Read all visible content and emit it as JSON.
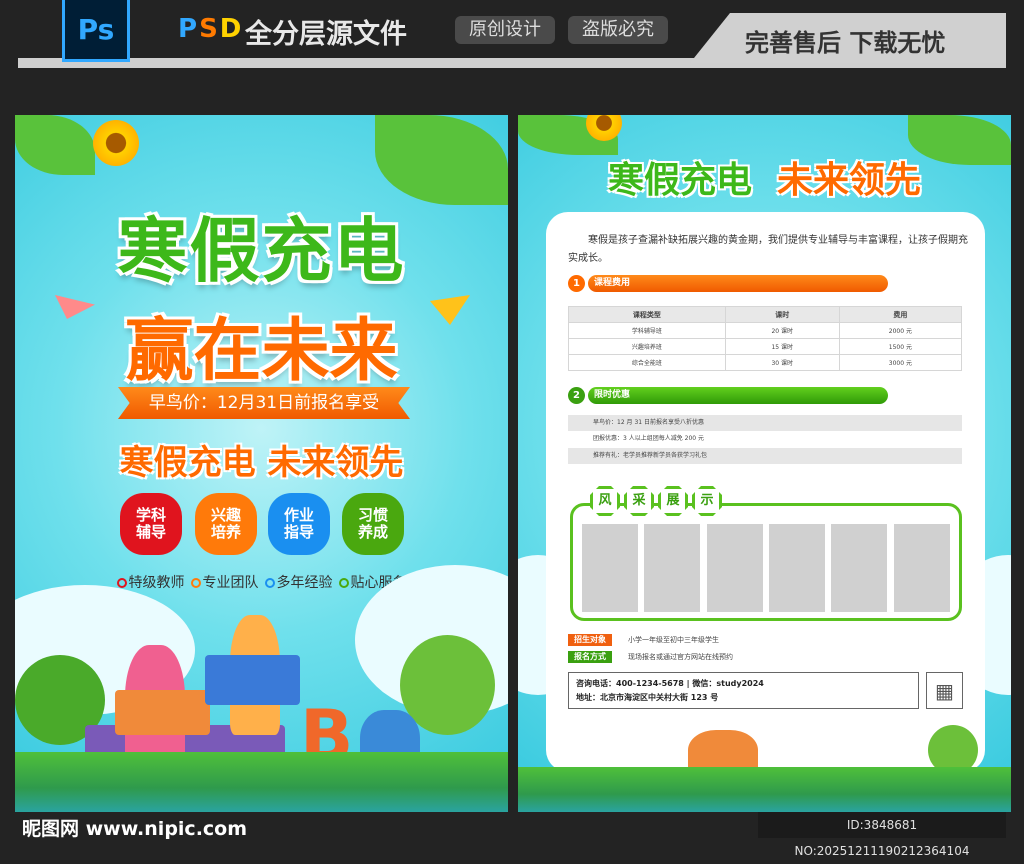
{
  "header": {
    "ps_icon_label": "Ps",
    "psd_p": "P",
    "psd_s": "S",
    "psd_d": "D",
    "title": "全分层源文件",
    "badges": [
      "原创设计",
      "盗版必究"
    ],
    "right_banner": "完善售后  下载无忧"
  },
  "poster_front": {
    "headline1": "寒假充电",
    "headline2": "赢在未来",
    "ribbon": "早鸟价：12月31日前报名享受",
    "slogan": "寒假充电  未来领先",
    "features": [
      {
        "label": "学科\n辅导",
        "color": "#e0141e"
      },
      {
        "label": "兴趣\n培养",
        "color": "#ff7a0a"
      },
      {
        "label": "作业\n指导",
        "color": "#1a8ff0"
      },
      {
        "label": "习惯\n养成",
        "color": "#4aa80f"
      }
    ],
    "bullets": [
      {
        "label": "特级教师",
        "color": "#e0141e"
      },
      {
        "label": "专业团队",
        "color": "#ff7a0a"
      },
      {
        "label": "多年经验",
        "color": "#1a8ff0"
      },
      {
        "label": "贴心服务",
        "color": "#4aa80f"
      }
    ],
    "letter_decor": "B"
  },
  "poster_back": {
    "title_green": "寒假充电",
    "title_orange": "未来领先",
    "intro": "寒假是孩子查漏补缺拓展兴趣的黄金期，我们提供专业辅导与丰富课程，让孩子假期充实成长。",
    "section1": {
      "number": "1",
      "title": "课程费用"
    },
    "table": {
      "headers": [
        "课程类型",
        "课时",
        "费用"
      ],
      "rows": [
        [
          "学科辅导班",
          "20 课时",
          "2000 元"
        ],
        [
          "兴趣培养班",
          "15 课时",
          "1500 元"
        ],
        [
          "综合全能班",
          "30 课时",
          "3000 元"
        ]
      ]
    },
    "section2": {
      "number": "2",
      "title": "限时优惠"
    },
    "promos": [
      "早鸟价：12 月 31 日前报名享受八折优惠",
      "团报优惠：3 人以上组团每人减免 200 元",
      "推荐有礼：老学员推荐新学员各获学习礼包"
    ],
    "gallery_tags": [
      "风",
      "采",
      "展",
      "示"
    ],
    "enroll_target_label": "招生对象",
    "enroll_target_value": "小学一年级至初中三年级学生",
    "enroll_method_label": "报名方式",
    "enroll_method_value": "现场报名或通过官方网站在线预约",
    "contact_line1": "咨询电话：400-1234-5678 | 微信：study2024",
    "contact_line2": "地址：北京市海淀区中关村大街 123 号"
  },
  "footer": {
    "site_logo": "昵图网 www.nipic.com",
    "id_text": "ID:3848681 NO:20251211190212364104"
  },
  "colors": {
    "green": "#3db81a",
    "orange": "#ff6a00",
    "sky": "#4fd3e6"
  }
}
